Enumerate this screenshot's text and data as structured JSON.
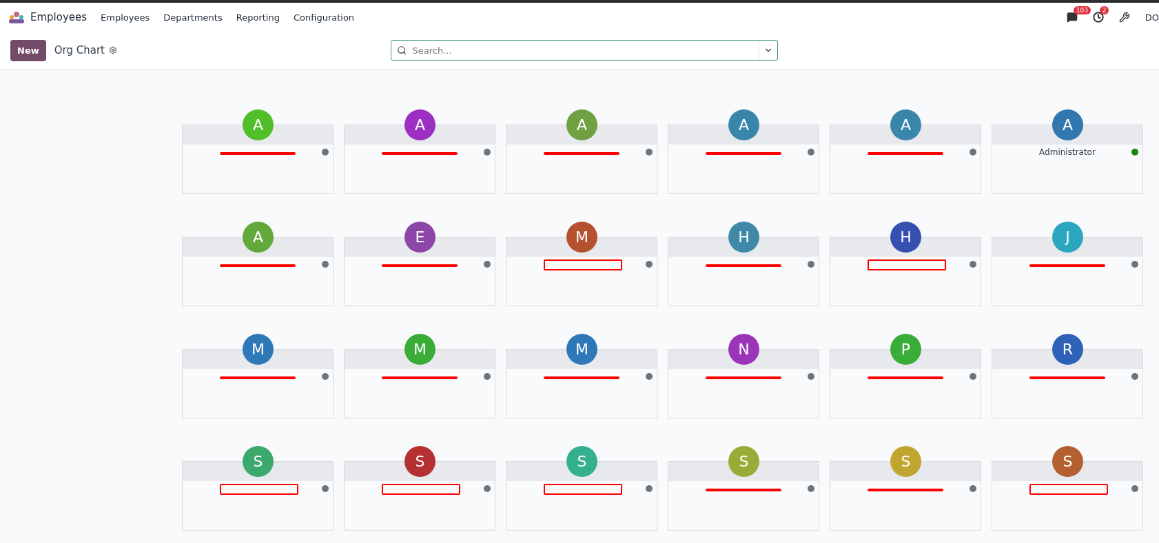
{
  "navbar": {
    "app_name": "Employees",
    "menu": [
      "Employees",
      "Departments",
      "Reporting",
      "Configuration"
    ],
    "messages_badge": "103",
    "activities_badge": "2",
    "user": "DO"
  },
  "control_panel": {
    "new_button": "New",
    "title": "Org Chart",
    "search_placeholder": "Search..."
  },
  "employees": [
    {
      "kind": "strike",
      "avatar": {
        "initial": "A",
        "color": "#52bf2a"
      },
      "status": {
        "color": "#6c757d"
      }
    },
    {
      "kind": "strike",
      "avatar": {
        "initial": "A",
        "color": "#9c2fc2"
      },
      "status": {
        "color": "#6c757d"
      }
    },
    {
      "kind": "strike",
      "avatar": {
        "initial": "A",
        "color": "#6fa041"
      },
      "status": {
        "color": "#6c757d"
      }
    },
    {
      "kind": "strike",
      "avatar": {
        "initial": "A",
        "color": "#3a86ab"
      },
      "status": {
        "color": "#6c757d"
      }
    },
    {
      "kind": "strike",
      "avatar": {
        "initial": "A",
        "color": "#3a86ab"
      },
      "status": {
        "color": "#6c757d"
      }
    },
    {
      "kind": "plain",
      "name": "Administrator",
      "avatar": {
        "initial": "A",
        "color": "#3178b0"
      },
      "status": {
        "color": "#10890e"
      }
    },
    {
      "kind": "strike",
      "avatar": {
        "initial": "A",
        "color": "#62a83a"
      },
      "status": {
        "color": "#6c757d"
      }
    },
    {
      "kind": "strike",
      "avatar": {
        "initial": "E",
        "color": "#8c46a8"
      },
      "status": {
        "color": "#6c757d"
      }
    },
    {
      "kind": "box",
      "avatar": {
        "initial": "M",
        "color": "#b5512e"
      },
      "status": {
        "color": "#6c757d"
      }
    },
    {
      "kind": "strike",
      "avatar": {
        "initial": "H",
        "color": "#3f88a8"
      },
      "status": {
        "color": "#6c757d"
      }
    },
    {
      "kind": "box",
      "avatar": {
        "initial": "H",
        "color": "#3650b0"
      },
      "status": {
        "color": "#6c757d"
      }
    },
    {
      "kind": "strike",
      "avatar": {
        "initial": "J",
        "color": "#2aa7bf"
      },
      "status": {
        "color": "#6c757d"
      }
    },
    {
      "kind": "strike",
      "avatar": {
        "initial": "M",
        "color": "#2f78b8"
      },
      "status": {
        "color": "#6c757d"
      }
    },
    {
      "kind": "strike",
      "avatar": {
        "initial": "M",
        "color": "#3aad38"
      },
      "status": {
        "color": "#6c757d"
      }
    },
    {
      "kind": "strike",
      "avatar": {
        "initial": "M",
        "color": "#2f78b8"
      },
      "status": {
        "color": "#6c757d"
      }
    },
    {
      "kind": "strike",
      "avatar": {
        "initial": "N",
        "color": "#9a35b8"
      },
      "status": {
        "color": "#6c757d"
      }
    },
    {
      "kind": "strike",
      "avatar": {
        "initial": "P",
        "color": "#3aad38"
      },
      "status": {
        "color": "#6c757d"
      }
    },
    {
      "kind": "strike",
      "avatar": {
        "initial": "R",
        "color": "#2e62b8"
      },
      "status": {
        "color": "#6c757d"
      }
    },
    {
      "kind": "box",
      "avatar": {
        "initial": "S",
        "color": "#3ba86e"
      },
      "status": {
        "color": "#6c757d"
      }
    },
    {
      "kind": "box",
      "avatar": {
        "initial": "S",
        "color": "#b53030"
      },
      "status": {
        "color": "#6c757d"
      }
    },
    {
      "kind": "box",
      "avatar": {
        "initial": "S",
        "color": "#35b08f"
      },
      "status": {
        "color": "#6c757d"
      }
    },
    {
      "kind": "strike",
      "avatar": {
        "initial": "S",
        "color": "#9aab38"
      },
      "status": {
        "color": "#6c757d"
      }
    },
    {
      "kind": "strike",
      "avatar": {
        "initial": "S",
        "color": "#c0a530"
      },
      "status": {
        "color": "#6c757d"
      }
    },
    {
      "kind": "box",
      "avatar": {
        "initial": "S",
        "color": "#b56030"
      },
      "status": {
        "color": "#6c757d"
      }
    }
  ]
}
